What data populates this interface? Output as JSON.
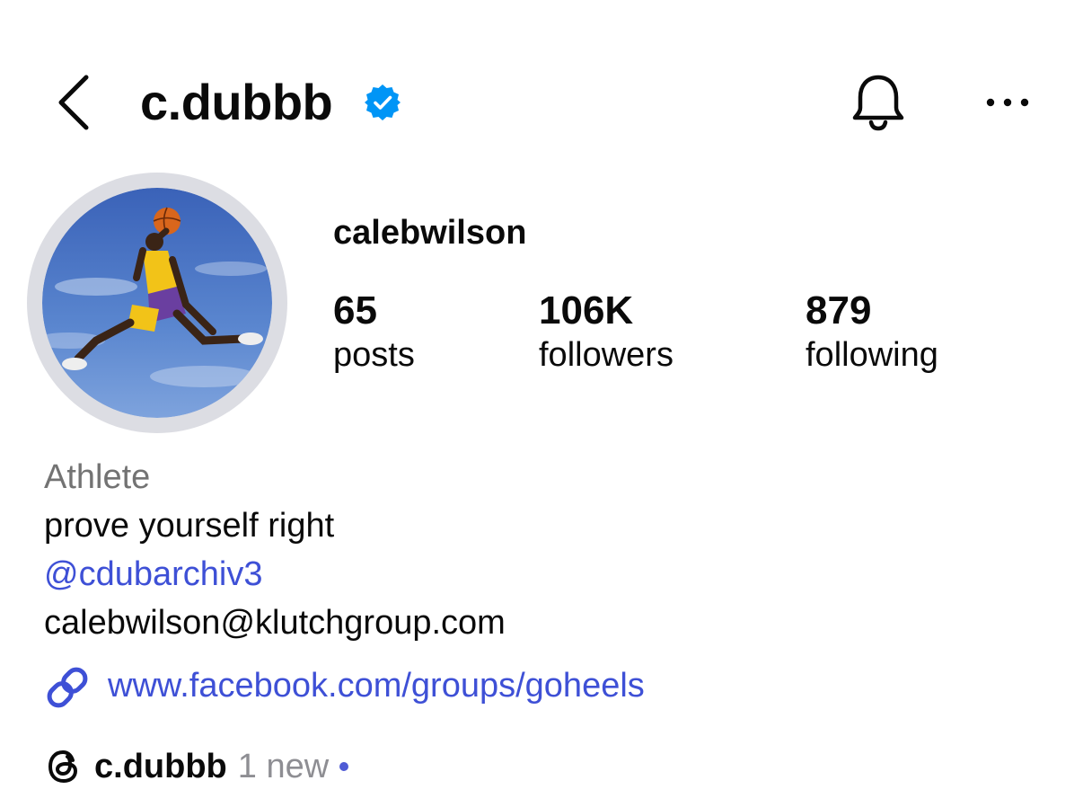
{
  "header": {
    "handle": "c.dubbb"
  },
  "profile": {
    "full_name": "calebwilson",
    "stats": [
      {
        "value": "65",
        "label": "posts"
      },
      {
        "value": "106K",
        "label": "followers"
      },
      {
        "value": "879",
        "label": "following"
      }
    ],
    "category": "Athlete",
    "bio": "prove yourself right",
    "mention": "@cdubarchiv3",
    "email": "calebwilson@klutchgroup.com",
    "link": "www.facebook.com/groups/goheels"
  },
  "threads": {
    "handle": "c.dubbb",
    "new_label": "1 new"
  },
  "colors": {
    "link": "#3e50d6",
    "verified": "#0095f6",
    "muted": "#737373"
  },
  "icons": [
    "back-icon",
    "verified-icon",
    "bell-icon",
    "more-icon",
    "link-icon",
    "threads-icon"
  ]
}
